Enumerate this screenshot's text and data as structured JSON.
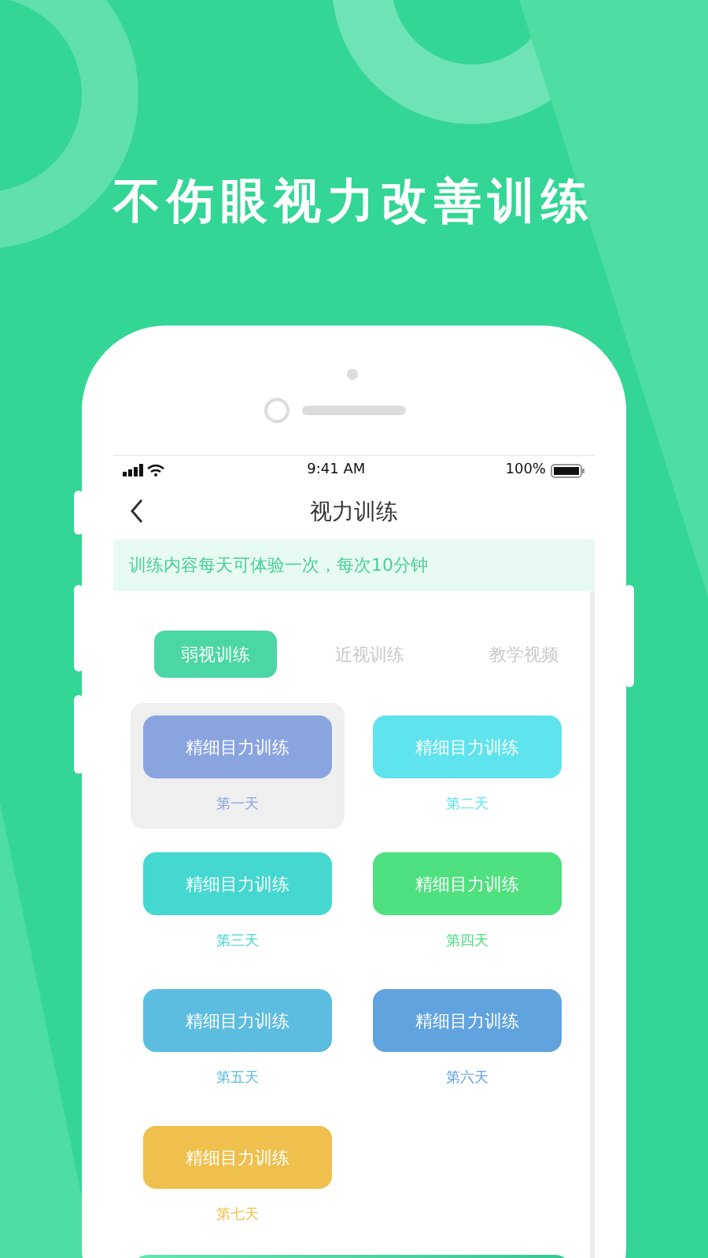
{
  "headline": "不伤眼视力改善训练",
  "status_bar": {
    "time": "9:41 AM",
    "battery": "100%"
  },
  "nav": {
    "title": "视力训练"
  },
  "notice": "训练内容每天可体验一次，每次10分钟",
  "tabs": [
    {
      "label": "弱视训练",
      "selected": true
    },
    {
      "label": "近视训练",
      "selected": false
    },
    {
      "label": "教学视频",
      "selected": false
    }
  ],
  "days": [
    {
      "button": "精细目力训练",
      "label": "第一天",
      "color": "#8aa4e0",
      "selected": true
    },
    {
      "button": "精细目力训练",
      "label": "第二天",
      "color": "#5fe4ee",
      "selected": false
    },
    {
      "button": "精细目力训练",
      "label": "第三天",
      "color": "#45d8d0",
      "selected": false
    },
    {
      "button": "精细目力训练",
      "label": "第四天",
      "color": "#4fe07f",
      "selected": false
    },
    {
      "button": "精细目力训练",
      "label": "第五天",
      "color": "#5dbde0",
      "selected": false
    },
    {
      "button": "精细目力训练",
      "label": "第六天",
      "color": "#60a3de",
      "selected": false
    },
    {
      "button": "精细目力训练",
      "label": "第七天",
      "color": "#f0c04e",
      "selected": false
    }
  ]
}
